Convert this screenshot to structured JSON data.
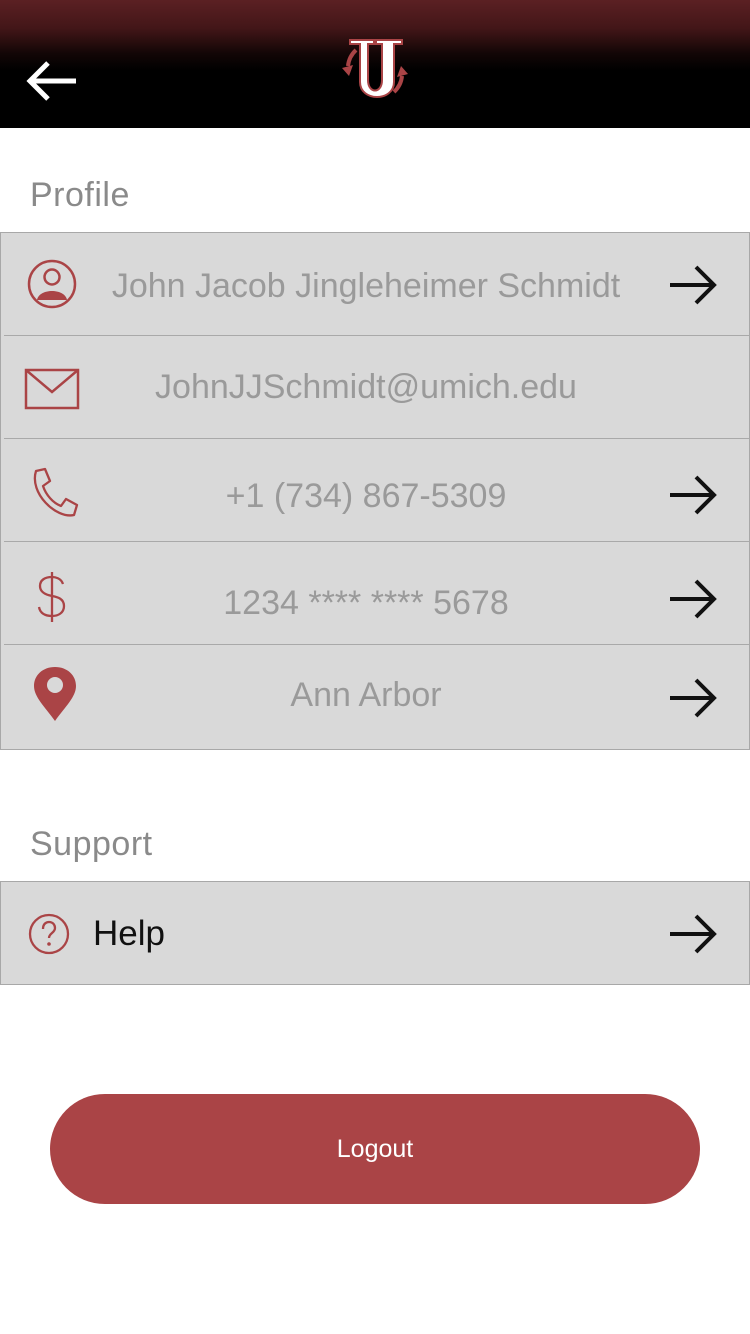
{
  "header": {
    "back_icon": "arrow-left-icon",
    "logo": {
      "letter": "U",
      "icon": "u-logo-with-cycle-arrows"
    }
  },
  "profile": {
    "title": "Profile",
    "items": [
      {
        "icon": "user-circle-icon",
        "text": "John Jacob Jingleheimer Schmidt",
        "has_arrow": true
      },
      {
        "icon": "envelope-icon",
        "text": "JohnJJSchmidt@umich.edu",
        "has_arrow": false
      },
      {
        "icon": "phone-icon",
        "text": "+1 (734) 867-5309",
        "has_arrow": true
      },
      {
        "icon": "dollar-icon",
        "text": "1234 **** **** 5678",
        "has_arrow": true
      },
      {
        "icon": "location-pin-icon",
        "text": "Ann Arbor",
        "has_arrow": true
      }
    ]
  },
  "support": {
    "title": "Support",
    "items": [
      {
        "icon": "question-circle-icon",
        "text": "Help",
        "has_arrow": true
      }
    ]
  },
  "logout": {
    "label": "Logout"
  },
  "colors": {
    "accent": "#aa4446",
    "header_top": "#5b2023",
    "header_bottom": "#000000",
    "panel_bg": "#d9d9d9",
    "muted_text": "#9a9a9a"
  }
}
